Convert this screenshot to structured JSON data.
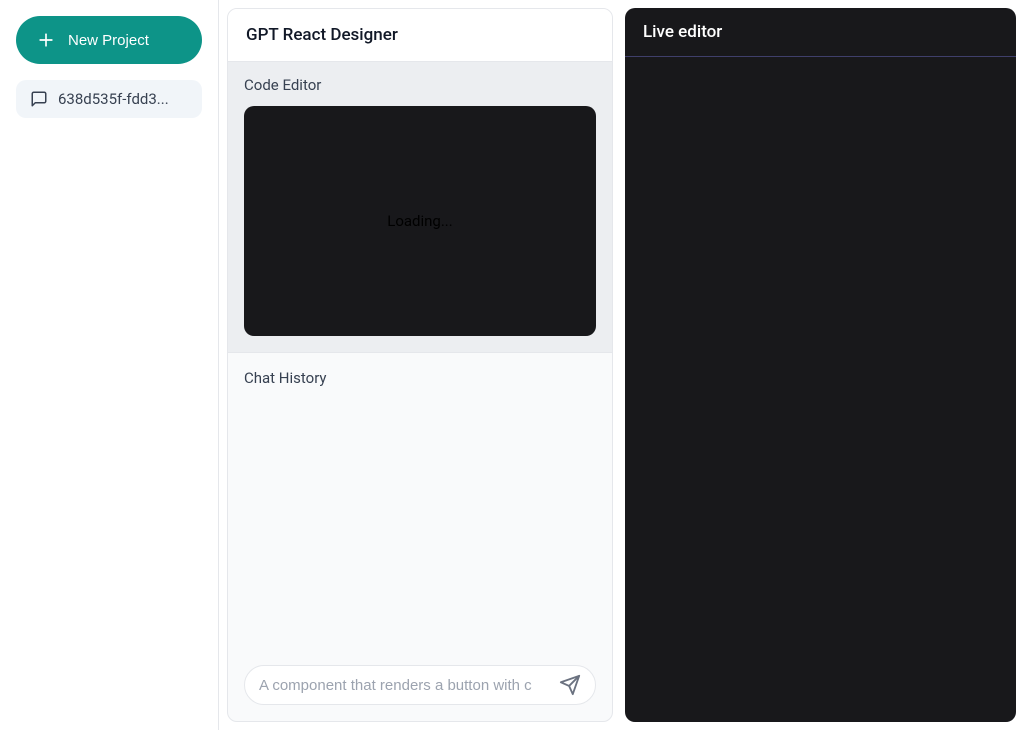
{
  "sidebar": {
    "new_project_label": "New Project",
    "items": [
      {
        "label": "638d535f-fdd3..."
      }
    ]
  },
  "center": {
    "title": "GPT React Designer",
    "code_editor_label": "Code Editor",
    "code_editor_status": "Loading...",
    "chat_history_label": "Chat History",
    "chat_input_placeholder": "A component that renders a button with c"
  },
  "preview": {
    "title": "Live editor"
  }
}
